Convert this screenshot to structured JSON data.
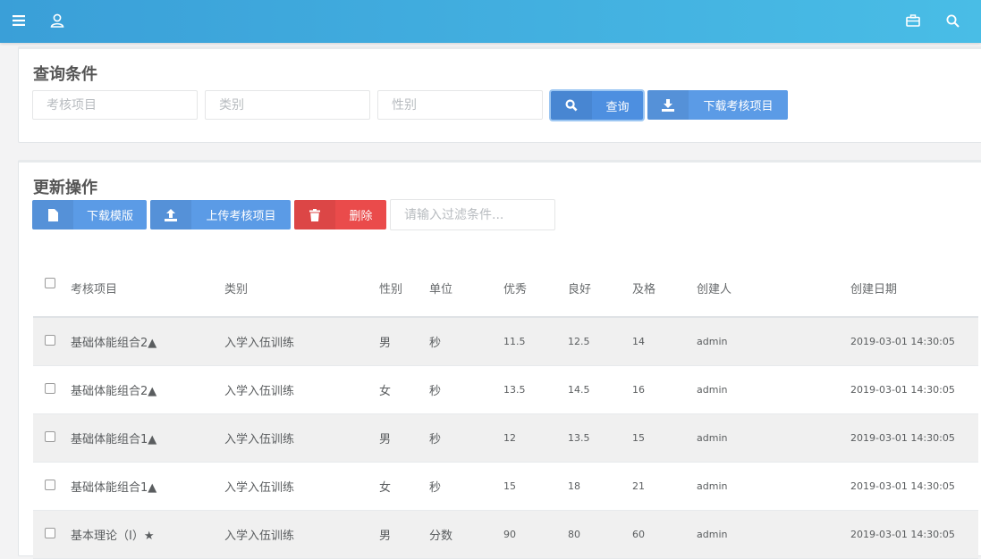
{
  "topbar": {
    "icons": [
      "menu-icon",
      "user-icon",
      "briefcase-icon",
      "search-icon"
    ],
    "color_start": "#3a9fd8",
    "color_end": "#49bde6"
  },
  "query_panel": {
    "title": "查询条件",
    "inputs": {
      "item_placeholder": "考核项目",
      "category_placeholder": "类别",
      "gender_placeholder": "性别"
    },
    "query_button": "查询",
    "download_items_button": "下载考核项目"
  },
  "update_panel": {
    "title": "更新操作",
    "download_template_button": "下载模版",
    "upload_items_button": "上传考核项目",
    "delete_button": "删除",
    "filter_placeholder": "请输入过滤条件..."
  },
  "table": {
    "headers": [
      "考核项目",
      "类别",
      "性别",
      "单位",
      "优秀",
      "良好",
      "及格",
      "创建人",
      "创建日期"
    ],
    "rows": [
      {
        "item": "基础体能组合2▲",
        "category": "入学入伍训练",
        "gender": "男",
        "unit": "秒",
        "excellent": "11.5",
        "good": "12.5",
        "pass": "14",
        "creator": "admin",
        "date": "2019-03-01 14:30:05"
      },
      {
        "item": "基础体能组合2▲",
        "category": "入学入伍训练",
        "gender": "女",
        "unit": "秒",
        "excellent": "13.5",
        "good": "14.5",
        "pass": "16",
        "creator": "admin",
        "date": "2019-03-01 14:30:05"
      },
      {
        "item": "基础体能组合1▲",
        "category": "入学入伍训练",
        "gender": "男",
        "unit": "秒",
        "excellent": "12",
        "good": "13.5",
        "pass": "15",
        "creator": "admin",
        "date": "2019-03-01 14:30:05"
      },
      {
        "item": "基础体能组合1▲",
        "category": "入学入伍训练",
        "gender": "女",
        "unit": "秒",
        "excellent": "15",
        "good": "18",
        "pass": "21",
        "creator": "admin",
        "date": "2019-03-01 14:30:05"
      },
      {
        "item": "基本理论（I）★",
        "category": "入学入伍训练",
        "gender": "男",
        "unit": "分数",
        "excellent": "90",
        "good": "80",
        "pass": "60",
        "creator": "admin",
        "date": "2019-03-01 14:30:05"
      }
    ]
  }
}
